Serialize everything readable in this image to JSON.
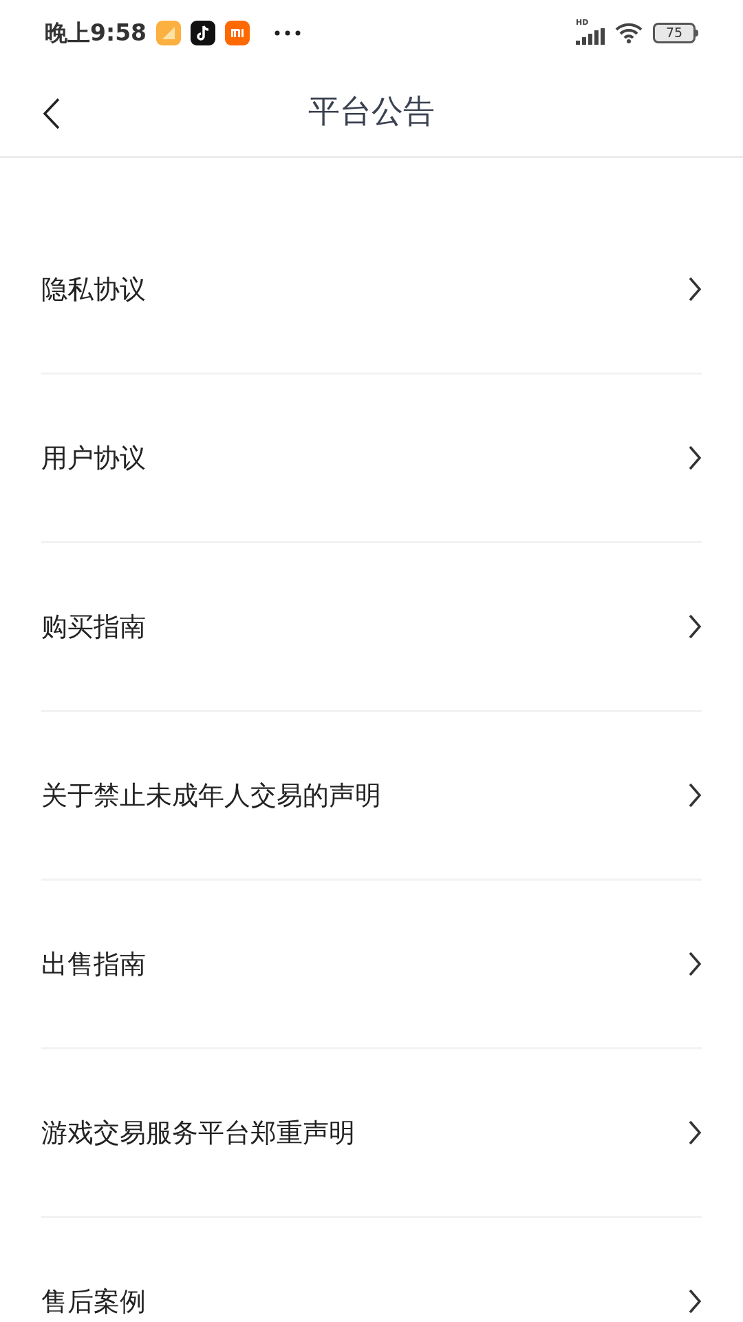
{
  "status_bar": {
    "time": "晚上9:58",
    "network_label": "HD",
    "battery": "75"
  },
  "header": {
    "title": "平台公告"
  },
  "items": [
    {
      "label": "隐私协议"
    },
    {
      "label": "用户协议"
    },
    {
      "label": "购买指南"
    },
    {
      "label": "关于禁止未成年人交易的声明"
    },
    {
      "label": "出售指南"
    },
    {
      "label": "游戏交易服务平台郑重声明"
    },
    {
      "label": "售后案例"
    }
  ]
}
